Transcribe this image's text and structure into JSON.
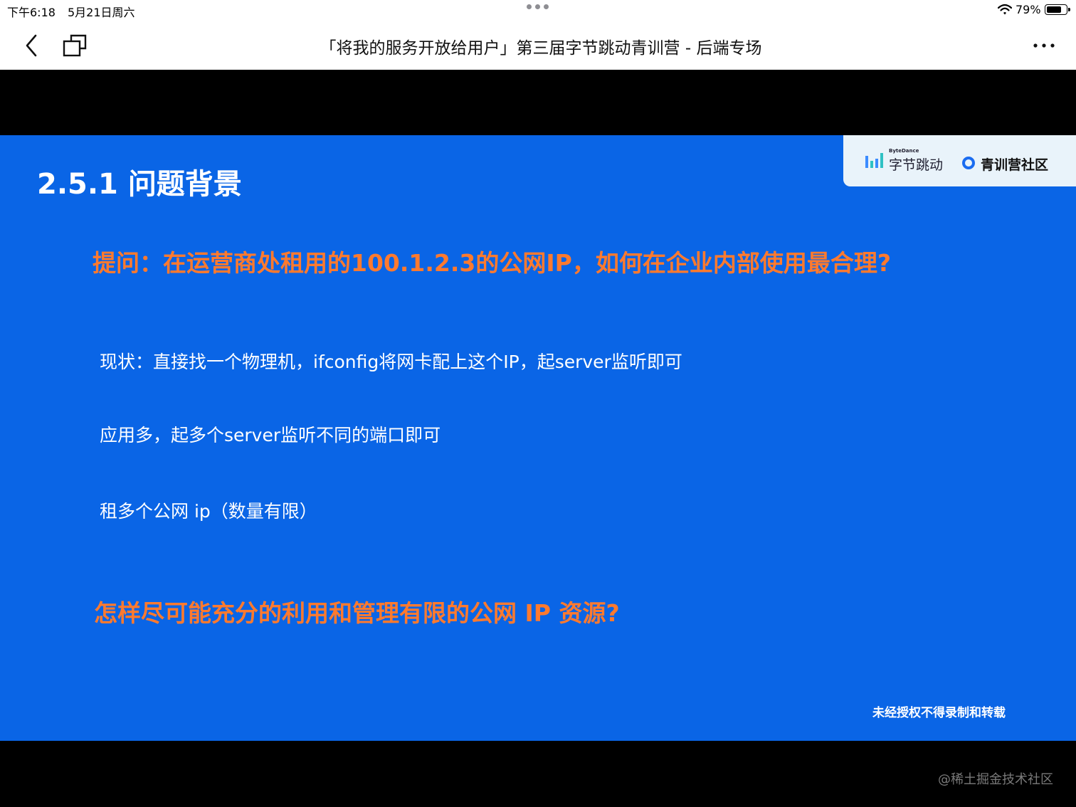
{
  "status_bar": {
    "time": "下午6:18",
    "date": "5月21日周六",
    "battery_percent": "79%",
    "battery_level": 0.79,
    "wifi_icon": "wifi-icon"
  },
  "nav": {
    "title": "「将我的服务开放给用户」第三届字节跳动青训营 - 后端专场",
    "back_icon": "chevron-left-icon",
    "window_icon": "window-icon",
    "more_icon": "more-icon"
  },
  "slide": {
    "background_color": "#0a65e6",
    "accent_color": "#ff7a2e",
    "logos": {
      "bytedance_small": "ByteDance",
      "bytedance_name": "字节跳动",
      "community_name": "青训营社区"
    },
    "title": "2.5.1 问题背景",
    "question": "提问：在运营商处租用的100.1.2.3的公网IP，如何在企业内部使用最合理?",
    "points": [
      "现状：直接找一个物理机，ifconfig将网卡配上这个IP，起server监听即可",
      "应用多，起多个server监听不同的端口即可",
      "租多个公网 ip（数量有限）"
    ],
    "closing_question": "怎样尽可能充分的利用和管理有限的公网 IP 资源?",
    "copyright": "未经授权不得录制和转载"
  },
  "watermark": "@稀土掘金技术社区"
}
